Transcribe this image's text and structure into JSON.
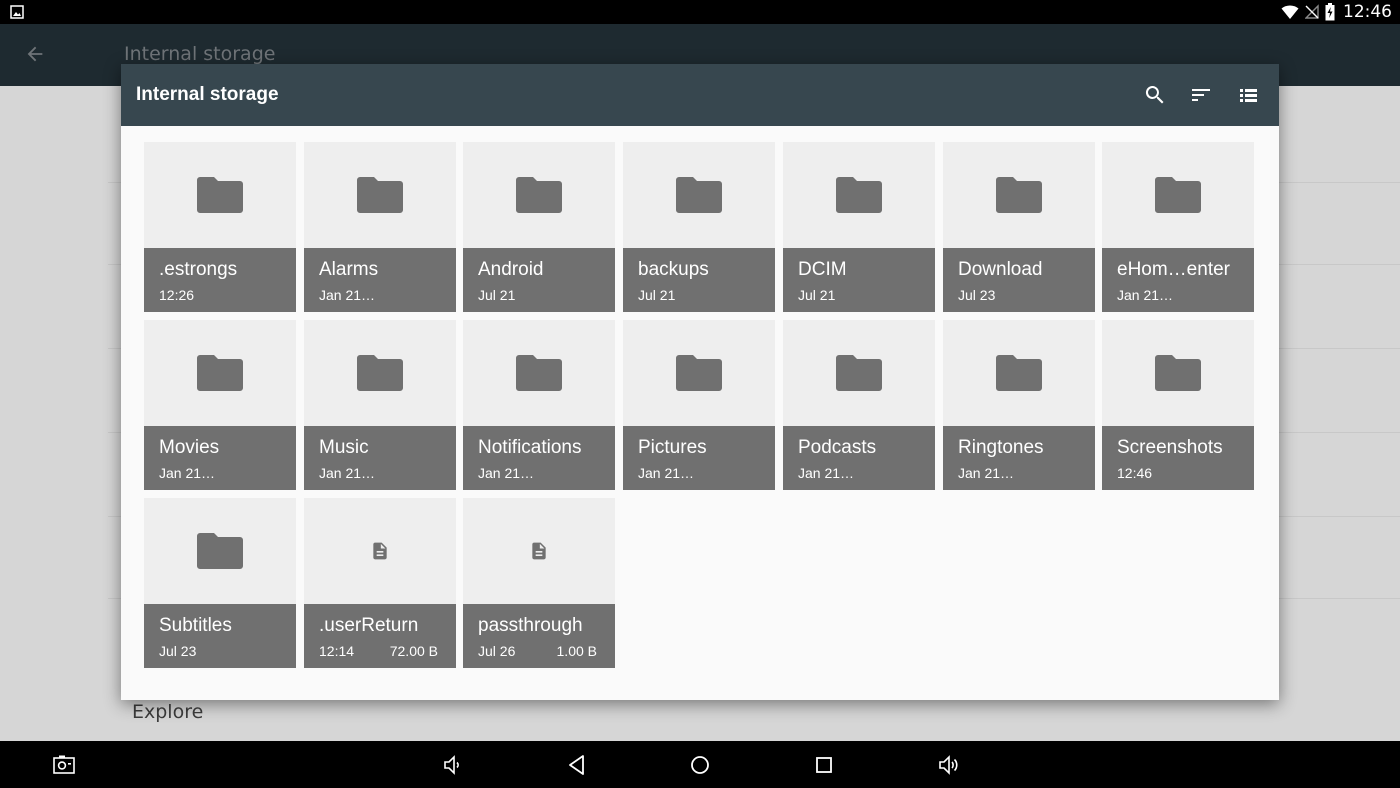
{
  "status_bar": {
    "time": "12:46",
    "left_icon": "image-icon",
    "icons": [
      "wifi-icon",
      "no-signal-icon",
      "battery-charging-icon"
    ]
  },
  "background_app": {
    "title": "Internal storage",
    "back_icon": "arrow-back-icon",
    "visible_item": "Explore"
  },
  "dialog": {
    "title": "Internal storage",
    "actions": [
      {
        "name": "search",
        "icon": "search-icon"
      },
      {
        "name": "sort",
        "icon": "sort-icon"
      },
      {
        "name": "view",
        "icon": "list-view-icon"
      }
    ],
    "items": [
      {
        "name": ".estrongs",
        "date": "12:26",
        "size": "",
        "type": "folder"
      },
      {
        "name": "Alarms",
        "date": "Jan 21…",
        "size": "",
        "type": "folder"
      },
      {
        "name": "Android",
        "date": "Jul 21",
        "size": "",
        "type": "folder"
      },
      {
        "name": "backups",
        "date": "Jul 21",
        "size": "",
        "type": "folder"
      },
      {
        "name": "DCIM",
        "date": "Jul 21",
        "size": "",
        "type": "folder"
      },
      {
        "name": "Download",
        "date": "Jul 23",
        "size": "",
        "type": "folder"
      },
      {
        "name": "eHom…enter",
        "date": "Jan 21…",
        "size": "",
        "type": "folder"
      },
      {
        "name": "Movies",
        "date": "Jan 21…",
        "size": "",
        "type": "folder"
      },
      {
        "name": "Music",
        "date": "Jan 21…",
        "size": "",
        "type": "folder"
      },
      {
        "name": "Notifications",
        "date": "Jan 21…",
        "size": "",
        "type": "folder"
      },
      {
        "name": "Pictures",
        "date": "Jan 21…",
        "size": "",
        "type": "folder"
      },
      {
        "name": "Podcasts",
        "date": "Jan 21…",
        "size": "",
        "type": "folder"
      },
      {
        "name": "Ringtones",
        "date": "Jan 21…",
        "size": "",
        "type": "folder"
      },
      {
        "name": "Screenshots",
        "date": "12:46",
        "size": "",
        "type": "folder"
      },
      {
        "name": "Subtitles",
        "date": "Jul 23",
        "size": "",
        "type": "folder"
      },
      {
        "name": ".userReturn",
        "date": "12:14",
        "size": "72.00 B",
        "type": "file"
      },
      {
        "name": "passthrough",
        "date": "Jul 26",
        "size": "1.00 B",
        "type": "file"
      }
    ]
  },
  "nav_bar": {
    "buttons": [
      "screenshot-icon",
      "volume-down-icon",
      "back-icon",
      "home-icon",
      "recents-icon",
      "volume-up-icon"
    ]
  },
  "colors": {
    "dialog_header": "#37474f",
    "tile_background": "#eeeeee",
    "tile_label": "#707070",
    "folder_icon": "#707070"
  }
}
